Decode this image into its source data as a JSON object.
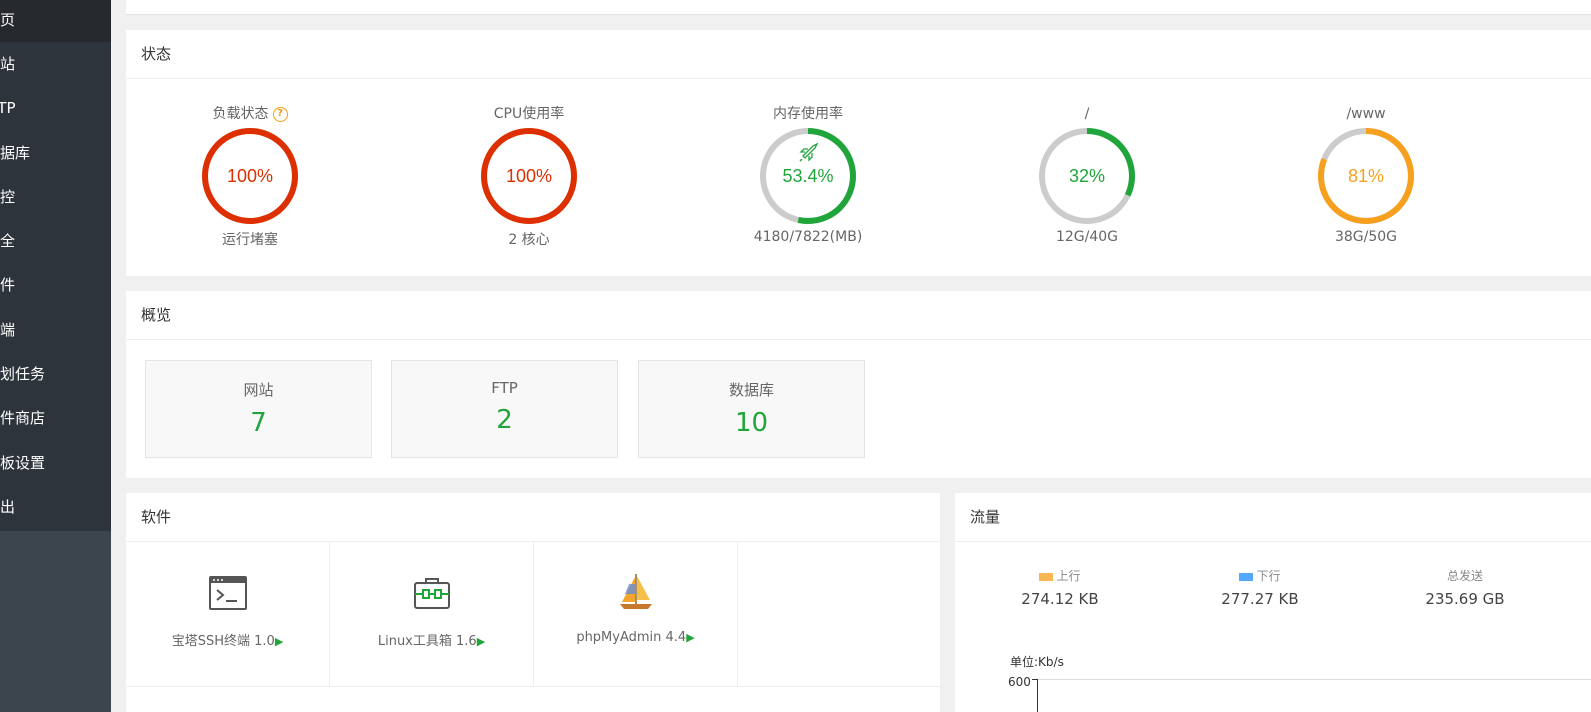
{
  "sidebar": {
    "items": [
      {
        "label": "首页",
        "active": true
      },
      {
        "label": "网站"
      },
      {
        "label": "FTP"
      },
      {
        "label": "数据库"
      },
      {
        "label": "监控"
      },
      {
        "label": "安全"
      },
      {
        "label": "文件"
      },
      {
        "label": "终端"
      },
      {
        "label": "计划任务"
      },
      {
        "label": "软件商店"
      },
      {
        "label": "面板设置"
      },
      {
        "label": "退出"
      }
    ]
  },
  "status": {
    "title": "状态",
    "gauges": [
      {
        "title": "负载状态",
        "value": "100%",
        "sub": "运行堵塞",
        "percent": 100,
        "color": "#dd2f00",
        "help": "?"
      },
      {
        "title": "CPU使用率",
        "value": "100%",
        "sub": "2 核心",
        "percent": 100,
        "color": "#dd2f00"
      },
      {
        "title": "内存使用率",
        "value": "53.4%",
        "sub": "4180/7822(MB)",
        "percent": 53.4,
        "color": "#20a53a",
        "icon": "rocket-icon"
      },
      {
        "title": "/",
        "value": "32%",
        "sub": "12G/40G",
        "percent": 32,
        "color": "#20a53a"
      },
      {
        "title": "/www",
        "value": "81%",
        "sub": "38G/50G",
        "percent": 81,
        "color": "#f7a01e"
      }
    ]
  },
  "overview": {
    "title": "概览",
    "cards": [
      {
        "label": "网站",
        "value": "7"
      },
      {
        "label": "FTP",
        "value": "2"
      },
      {
        "label": "数据库",
        "value": "10"
      }
    ]
  },
  "software": {
    "title": "软件",
    "items": [
      {
        "name": "宝塔SSH终端 1.0",
        "icon": "terminal-icon"
      },
      {
        "name": "Linux工具箱 1.6",
        "icon": "toolbox-icon"
      },
      {
        "name": "phpMyAdmin 4.4",
        "icon": "sailboat-icon"
      }
    ],
    "play": "▶"
  },
  "traffic": {
    "title": "流量",
    "stats": [
      {
        "label": "上行",
        "value": "274.12 KB",
        "color": "#f7b851"
      },
      {
        "label": "下行",
        "value": "277.27 KB",
        "color": "#52a9ff"
      },
      {
        "label": "总发送",
        "value": "235.69 GB"
      }
    ],
    "unit": "单位:Kb/s",
    "ytick": "600"
  }
}
